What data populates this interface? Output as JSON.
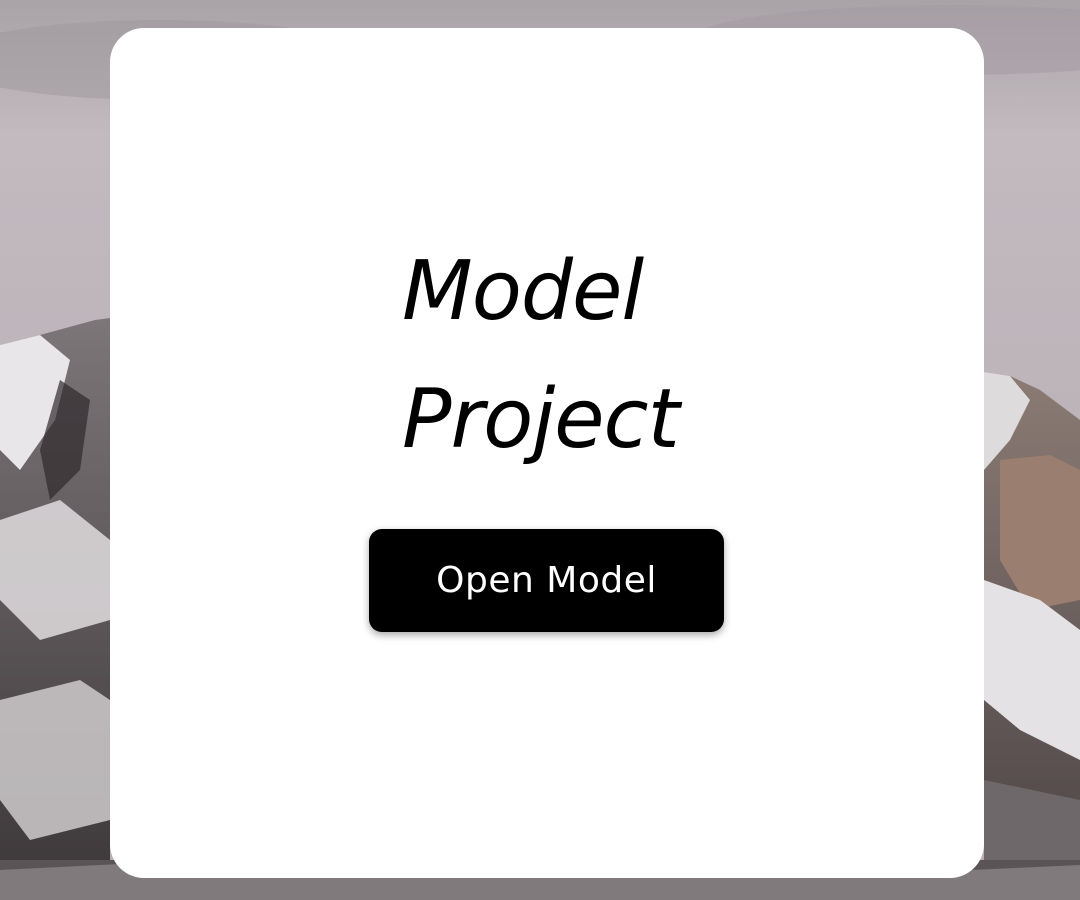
{
  "card": {
    "title_line1": "Model",
    "title_line2": "Project"
  },
  "actions": {
    "open_model_label": "Open Model"
  },
  "background": {
    "description_icon": "mountain-landscape",
    "sky_color": "#bdb4ba",
    "rock_color": "#4a4446",
    "snow_color": "#e6e4e6",
    "card_color": "#ffffff",
    "button_color": "#000000"
  }
}
